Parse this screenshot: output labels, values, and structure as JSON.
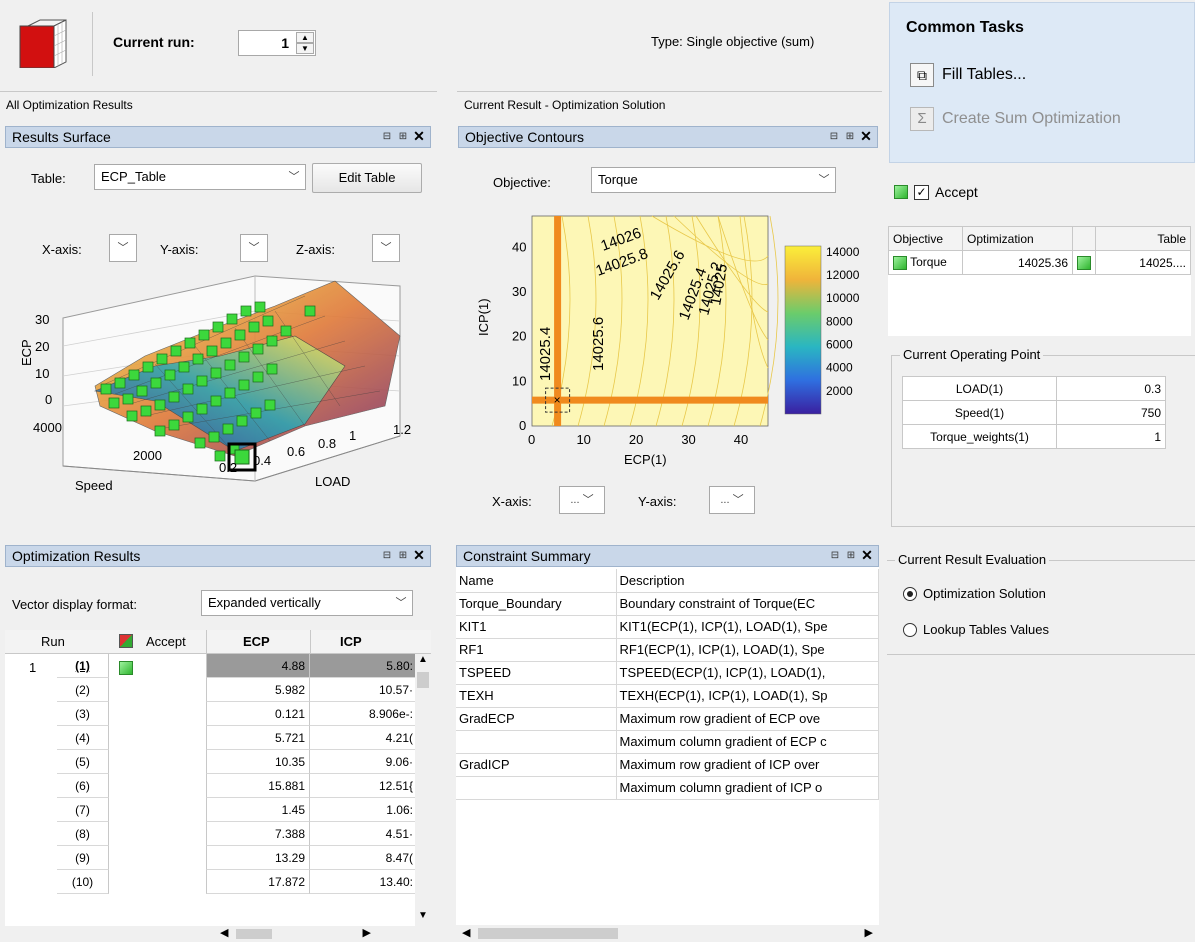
{
  "toolbar": {
    "run_label": "Current run:",
    "run_value": "1",
    "type_text": "Type: Single objective (sum)"
  },
  "all_results_label": "All Optimization Results",
  "current_result_label": "Current Result - Optimization Solution",
  "results_surface": {
    "title": "Results Surface",
    "table_label": "Table:",
    "table_value": "ECP_Table",
    "edit_button": "Edit Table",
    "xaxis_label": "X-axis:",
    "yaxis_label": "Y-axis:",
    "zaxis_label": "Z-axis:",
    "zlabel": "ECP",
    "speed_label": "Speed",
    "load_label": "LOAD",
    "z_ticks": [
      "30",
      "20",
      "10",
      "0"
    ],
    "speed_ticks": [
      "4000",
      "2000"
    ],
    "load_ticks": [
      "0.2",
      "0.4",
      "0.6",
      "0.8",
      "1",
      "1.2"
    ]
  },
  "objective_contours": {
    "title": "Objective Contours",
    "objective_label": "Objective:",
    "objective_value": "Torque",
    "xaxis_label": "X-axis:",
    "yaxis_label": "Y-axis:",
    "xaxis_value": "...",
    "yaxis_value": "..."
  },
  "chart_data": {
    "type": "heatmap",
    "xlabel": "ECP(1)",
    "ylabel": "ICP(1)",
    "xlim": [
      0,
      45
    ],
    "ylim": [
      0,
      47
    ],
    "x_ticks": [
      0,
      10,
      20,
      30,
      40
    ],
    "y_ticks": [
      0,
      10,
      20,
      30,
      40
    ],
    "colorbar_ticks": [
      14000,
      12000,
      10000,
      8000,
      6000,
      4000,
      2000
    ],
    "colorbar_range": [
      0,
      14500
    ],
    "contour_labels": [
      "14026",
      "14025.8",
      "14025.6",
      "14025.4",
      "14025.2",
      "14025",
      "14025.4",
      "14025.6"
    ],
    "optimum": {
      "x": 4.88,
      "y": 5.8
    },
    "boundary_lines": {
      "x": 4.88,
      "y": 5.8
    }
  },
  "common_tasks": {
    "title": "Common Tasks",
    "fill_tables": "Fill Tables...",
    "create_sum": "Create Sum Optimization",
    "accept_label": "Accept"
  },
  "objective_table": {
    "headers": [
      "Objective",
      "Optimization",
      "",
      "Table"
    ],
    "row": {
      "name": "Torque",
      "optimization": "14025.36",
      "table": "14025...."
    }
  },
  "operating_point": {
    "title": "Current Operating Point",
    "rows": [
      {
        "name": "LOAD(1)",
        "value": "0.3"
      },
      {
        "name": "Speed(1)",
        "value": "750"
      },
      {
        "name": "Torque_weights(1)",
        "value": "1"
      }
    ]
  },
  "evaluation": {
    "title": "Current Result Evaluation",
    "option1": "Optimization Solution",
    "option2": "Lookup Tables Values"
  },
  "opt_results": {
    "title": "Optimization Results",
    "format_label": "Vector display format:",
    "format_value": "Expanded vertically",
    "headers": {
      "run": "Run",
      "accept": "Accept",
      "ecp": "ECP",
      "icp": "ICP"
    },
    "run_number": "1",
    "rows": [
      {
        "idx": "(1)",
        "ecp": "4.88",
        "icp": "5.80:"
      },
      {
        "idx": "(2)",
        "ecp": "5.982",
        "icp": "10.57·"
      },
      {
        "idx": "(3)",
        "ecp": "0.121",
        "icp": "8.906e-:"
      },
      {
        "idx": "(4)",
        "ecp": "5.721",
        "icp": "4.21("
      },
      {
        "idx": "(5)",
        "ecp": "10.35",
        "icp": "9.06·"
      },
      {
        "idx": "(6)",
        "ecp": "15.881",
        "icp": "12.51{"
      },
      {
        "idx": "(7)",
        "ecp": "1.45",
        "icp": "1.06:"
      },
      {
        "idx": "(8)",
        "ecp": "7.388",
        "icp": "4.51·"
      },
      {
        "idx": "(9)",
        "ecp": "13.29",
        "icp": "8.47("
      },
      {
        "idx": "(10)",
        "ecp": "17.872",
        "icp": "13.40:"
      }
    ]
  },
  "constraint_summary": {
    "title": "Constraint Summary",
    "headers": {
      "name": "Name",
      "desc": "Description"
    },
    "rows": [
      {
        "name": "Torque_Boundary",
        "desc": "Boundary constraint of Torque(EC"
      },
      {
        "name": "KIT1",
        "desc": "KIT1(ECP(1), ICP(1), LOAD(1), Spe"
      },
      {
        "name": "RF1",
        "desc": "RF1(ECP(1), ICP(1), LOAD(1), Spe"
      },
      {
        "name": "TSPEED",
        "desc": "TSPEED(ECP(1), ICP(1), LOAD(1),"
      },
      {
        "name": "TEXH",
        "desc": "TEXH(ECP(1), ICP(1), LOAD(1), Sp"
      },
      {
        "name": "GradECP",
        "desc": "Maximum row gradient of ECP ove"
      },
      {
        "name": "",
        "desc": "Maximum column gradient of ECP c"
      },
      {
        "name": "GradICP",
        "desc": "Maximum row gradient of ICP over"
      },
      {
        "name": "",
        "desc": "Maximum column gradient of ICP o"
      }
    ]
  }
}
